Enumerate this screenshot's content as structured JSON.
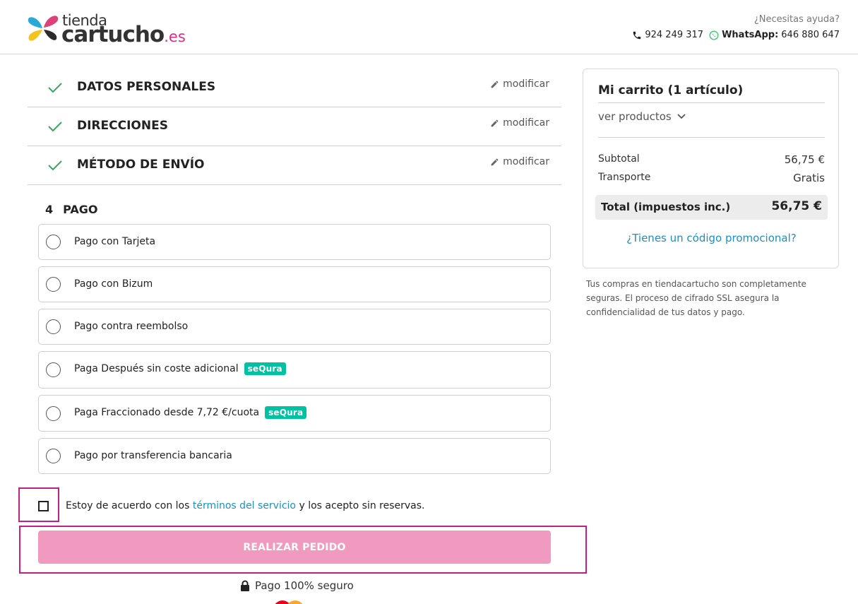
{
  "header": {
    "logo_top": "tienda",
    "logo_main": "cartucho",
    "logo_suffix": ".es",
    "help_text": "¿Necesitas ayuda?",
    "phone": "924 249 317",
    "whatsapp_label": "WhatsApp:",
    "whatsapp_number": "646 880 647"
  },
  "steps": [
    {
      "title": "DATOS PERSONALES",
      "edit_label": "modificar"
    },
    {
      "title": "DIRECCIONES",
      "edit_label": "modificar"
    },
    {
      "title": "MÉTODO DE ENVÍO",
      "edit_label": "modificar"
    }
  ],
  "payment": {
    "step_number": "4",
    "title": "PAGO",
    "options": [
      {
        "label": "Pago con Tarjeta"
      },
      {
        "label": "Pago con Bizum"
      },
      {
        "label": "Pago contra reembolso"
      },
      {
        "label": "Paga Después sin coste adicional",
        "badge": "seQura"
      },
      {
        "label": "Paga Fraccionado desde 7,72 €/cuota",
        "badge": "seQura"
      },
      {
        "label": "Pago por transferencia bancaria"
      }
    ]
  },
  "terms": {
    "prefix": "Estoy de acuerdo con los",
    "link": "términos del servicio",
    "suffix": "y los acepto sin reservas."
  },
  "order_button": "REALIZAR PEDIDO",
  "secure_text": "Pago 100% seguro",
  "cart": {
    "title": "Mi carrito (1 artículo)",
    "view_products": "ver productos",
    "subtotal_label": "Subtotal",
    "subtotal_value": "56,75 €",
    "shipping_label": "Transporte",
    "shipping_value": "Gratis",
    "total_label": "Total (impuestos inc.)",
    "total_value": "56,75 €",
    "promo_link": "¿Tienes un código promocional?"
  },
  "security_note": "Tus compras en tiendacartucho son completamente seguras. El proceso de cifrado SSL asegura la confidencialidad de tus datos y pago.",
  "colors": {
    "brand_pink": "#d63384",
    "button_pink": "#f09ac0",
    "link_blue": "#1a90c6",
    "check_green": "#3aa564",
    "sequra_teal": "#00c2a3",
    "highlight": "#c0208a"
  }
}
